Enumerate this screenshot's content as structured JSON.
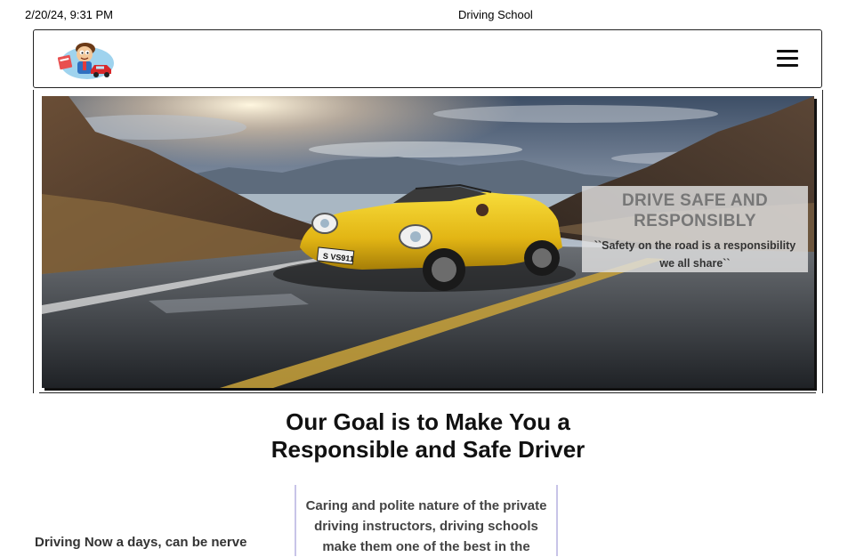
{
  "print_header": {
    "datetime": "2/20/24, 9:31 PM",
    "page_title": "Driving School"
  },
  "navbar": {
    "logo_icon": "driving-school-cartoon-logo",
    "menu_icon": "hamburger-menu-icon"
  },
  "hero": {
    "image": "yellow-convertible-on-mountain-road",
    "card_title": "DRIVE SAFE AND RESPONSIBLY",
    "card_quote": "``Safety on the road is a responsibility we all share``",
    "license_plate": "S​VS911"
  },
  "goal": {
    "title": "Our Goal is to Make You a Responsible and Safe Driver"
  },
  "content": {
    "intro_text": "Driving Now a days, can be nerve",
    "panel_text": "Caring and polite nature of the private driving instructors, driving schools make them one of the best in the"
  },
  "colors": {
    "car_yellow": "#e8c020",
    "panel_border": "#c8c4e8",
    "card_title": "#777777"
  }
}
